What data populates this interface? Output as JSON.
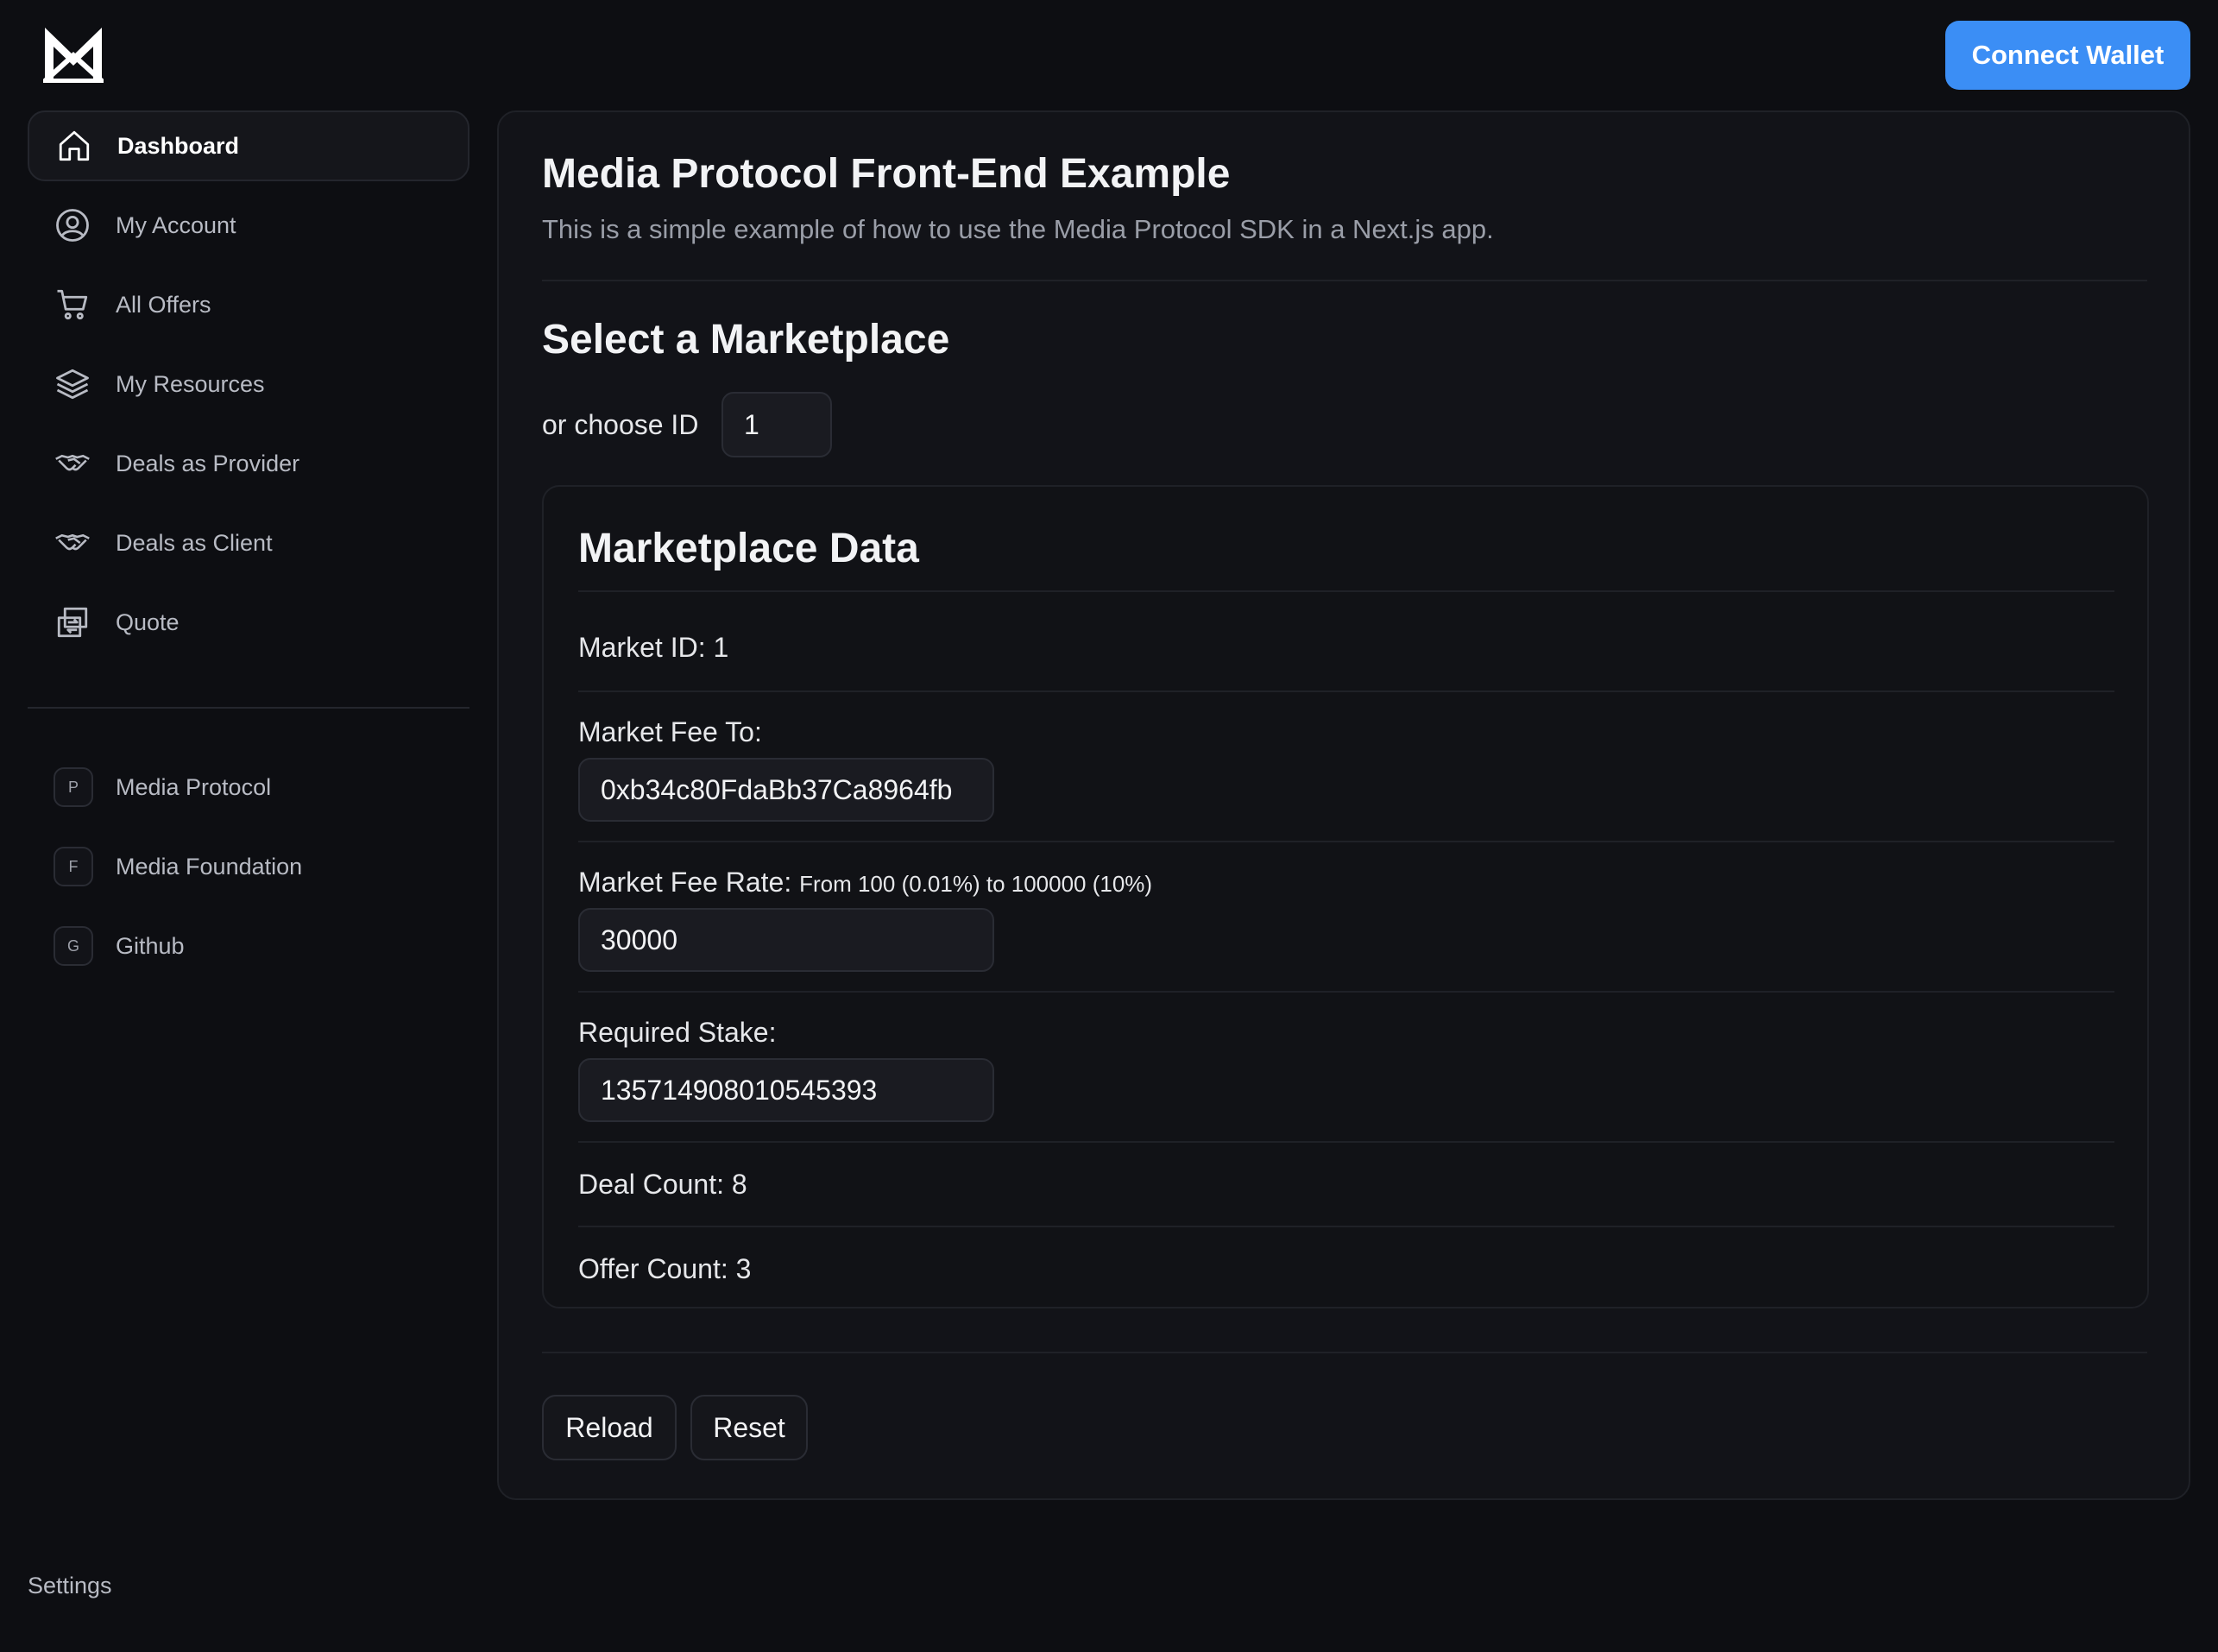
{
  "header": {
    "logo_icon": "media-logo-icon",
    "connect_wallet_label": "Connect Wallet",
    "accent_color": "#3b8ef5"
  },
  "sidebar": {
    "items": [
      {
        "label": "Dashboard",
        "icon": "home-icon",
        "active": true
      },
      {
        "label": "My Account",
        "icon": "user-circle-icon"
      },
      {
        "label": "All Offers",
        "icon": "cart-icon"
      },
      {
        "label": "My Resources",
        "icon": "layers-icon"
      },
      {
        "label": "Deals as Provider",
        "icon": "handshake-icon"
      },
      {
        "label": "Deals as Client",
        "icon": "handshake-icon"
      },
      {
        "label": "Quote",
        "icon": "swap-icon"
      }
    ],
    "external_links": [
      {
        "badge": "P",
        "label": "Media Protocol"
      },
      {
        "badge": "F",
        "label": "Media Foundation"
      },
      {
        "badge": "G",
        "label": "Github"
      }
    ],
    "settings_label": "Settings"
  },
  "main": {
    "title": "Media Protocol Front-End Example",
    "subtitle": "This is a simple example of how to use the Media Protocol SDK in a Next.js app.",
    "section_title": "Select a Marketplace",
    "choose_id_label": "or choose ID",
    "choose_id_value": "1",
    "marketplace": {
      "title": "Marketplace Data",
      "market_id_text": "Market ID: 1",
      "fee_to_label": "Market Fee To:",
      "fee_to_value": "0xb34c80FdaBb37Ca8964fb",
      "fee_rate_label": "Market Fee Rate:",
      "fee_rate_hint": "From 100 (0.01%) to 100000 (10%)",
      "fee_rate_value": "30000",
      "stake_label": "Required Stake:",
      "stake_value": "135714908010545393",
      "deal_count_text": "Deal Count: 8",
      "offer_count_text": "Offer Count: 3"
    },
    "reload_label": "Reload",
    "reset_label": "Reset"
  }
}
